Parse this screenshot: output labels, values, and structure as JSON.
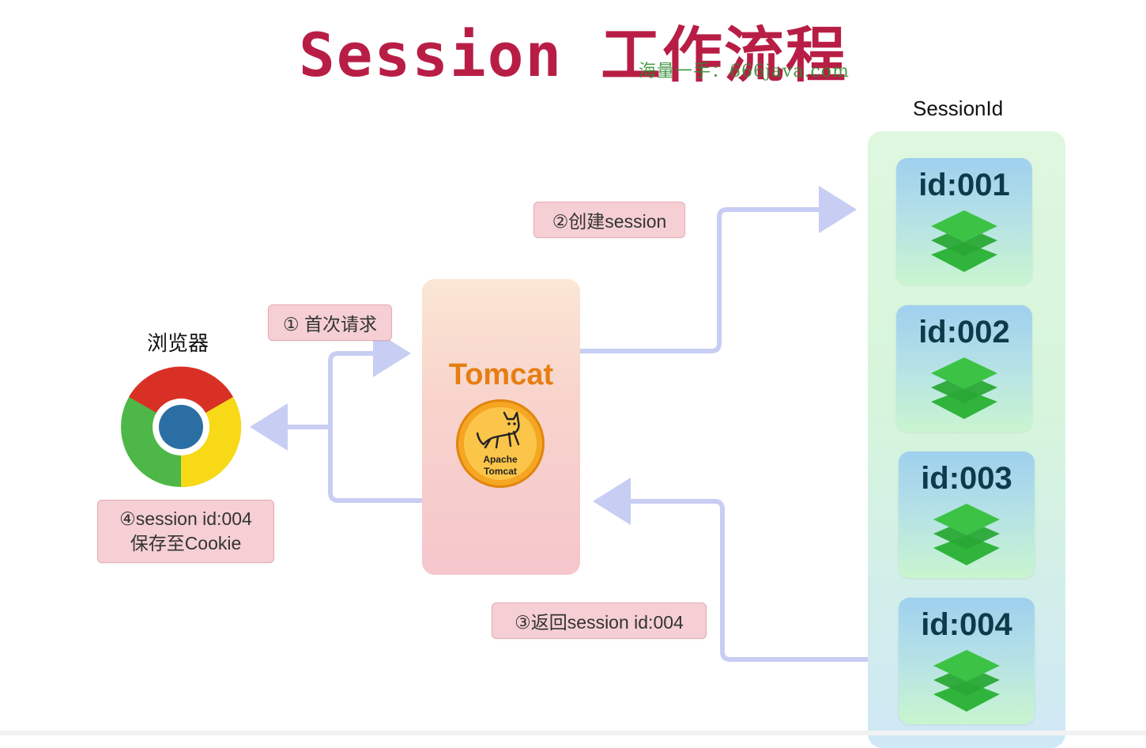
{
  "title": "Session 工作流程",
  "watermark": "海量一手：666java.com",
  "browser": {
    "label": "浏览器",
    "icon": "chrome-browser-icon"
  },
  "steps": {
    "first_request": "① 首次请求",
    "create_session": "②创建session",
    "return_session": "③返回session id:004",
    "save_cookie_line1": "④session id:004",
    "save_cookie_line2": "保存至Cookie"
  },
  "server": {
    "name": "Tomcat",
    "logo_line1": "Apache",
    "logo_line2": "Tomcat",
    "icon": "apache-tomcat-logo-icon"
  },
  "session_store": {
    "header": "SessionId",
    "ids": [
      "id:001",
      "id:002",
      "id:003",
      "id:004"
    ],
    "item_icon": "layers-stack-icon"
  },
  "colors": {
    "title": "#b81e45",
    "tag_bg": "#f5cfd4",
    "arrow": "#c8cdf3",
    "tomcat_text": "#e57e12",
    "stack_green": "#2fb83a"
  }
}
